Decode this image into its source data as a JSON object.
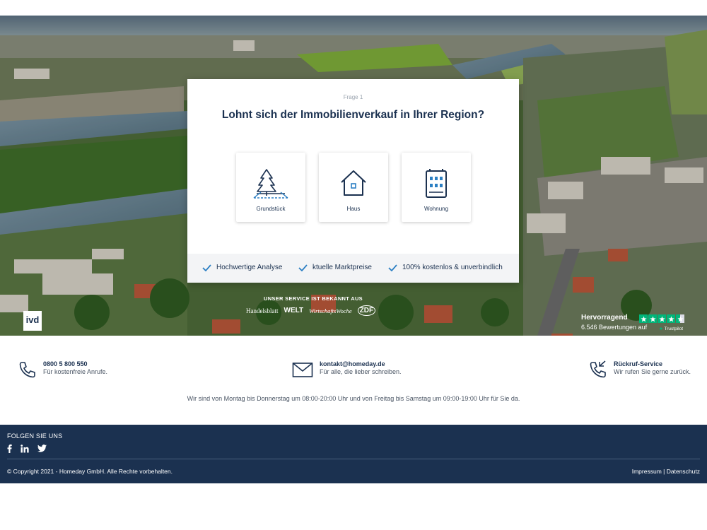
{
  "card": {
    "step": "Frage 1",
    "question": "Lohnt sich der Immobilienverkauf in Ihrer Region?",
    "options": [
      {
        "label": "Grundstück",
        "icon": "tree-plot-icon"
      },
      {
        "label": "Haus",
        "icon": "house-icon"
      },
      {
        "label": "Wohnung",
        "icon": "apartment-building-icon"
      }
    ],
    "benefits": [
      "Hochwertige Analyse",
      "ktuelle Marktpreise",
      "100% kostenlos & unverbindlich"
    ]
  },
  "press": {
    "title": "UNSER SERVICE IST BEKANNT AUS",
    "logos": [
      "Handelsblatt",
      "WELT",
      "WirtschaftsWoche",
      "ZDF"
    ]
  },
  "ivd": {
    "logo_text": "ivd"
  },
  "trustpilot": {
    "label": "Hervorragend",
    "reviews": "6.546 Bewertungen auf",
    "brand": "Trustpilot",
    "rating_stars": 4.5,
    "star_color": "#00b67a"
  },
  "contact": {
    "phone": {
      "title": "0800 5 800 550",
      "sub": "Für kostenfreie Anrufe."
    },
    "email": {
      "title": "kontakt@homeday.de",
      "sub": "Für alle, die lieber schreiben."
    },
    "callback": {
      "title": "Rückruf-Service",
      "sub": "Wir rufen Sie gerne zurück."
    },
    "hours": "Wir sind von Montag bis Donnerstag um 08:00-20:00 Uhr und von Freitag bis Samstag um 09:00-19:00 Uhr für Sie da."
  },
  "footer": {
    "follow": "FOLGEN SIE UNS",
    "social": [
      "facebook-icon",
      "linkedin-icon",
      "twitter-icon"
    ],
    "copyright": "© Copyright 2021 - Homeday GmbH. Alle Rechte vorbehalten.",
    "impressum": "Impressum",
    "separator": "|",
    "datenschutz": "Datenschutz"
  },
  "colors": {
    "navy": "#1b3150",
    "accent": "#2b7fc3",
    "trustpilot": "#00b67a"
  }
}
